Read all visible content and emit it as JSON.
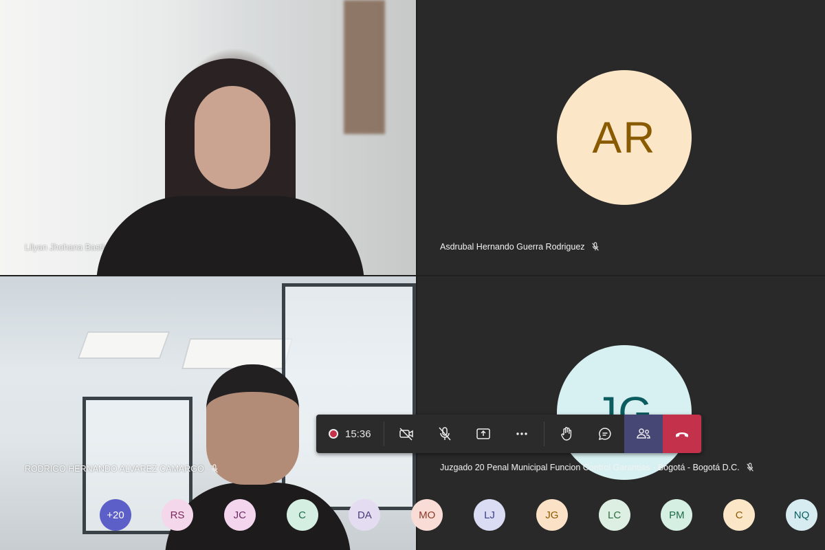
{
  "participants": {
    "tile1_name": "Lilyan Jhohana Bastidas Huertas",
    "tile2_name": "Asdrubal Hernando Guerra Rodriguez",
    "tile2_initials": "AR",
    "tile3_name": "RODRIGO HERNANDO ALVAREZ CAMARGO",
    "tile4_name": "Juzgado 20 Penal Municipal Funcion Control Garantias - Bogotá - Bogotá D.C.",
    "tile4_initials": "JG"
  },
  "toolbar": {
    "timer": "15:36",
    "icons": [
      "record-icon",
      "camera-off-icon",
      "mic-off-icon",
      "share-screen-icon",
      "more-icon",
      "raise-hand-icon",
      "chat-icon",
      "participants-icon",
      "hang-up-icon"
    ]
  },
  "overflow": {
    "more_count": "+20",
    "avatars": [
      {
        "initials": "RS",
        "bg": "#f4d7ea",
        "fg": "#7a2a5c"
      },
      {
        "initials": "JC",
        "bg": "#f3d6ee",
        "fg": "#6b2c62"
      },
      {
        "initials": "C",
        "bg": "#d4efe2",
        "fg": "#1f6b48"
      },
      {
        "initials": "DA",
        "bg": "#e4dcf1",
        "fg": "#4a3a7a"
      },
      {
        "initials": "MO",
        "bg": "#f9dcd6",
        "fg": "#8a3a2a"
      },
      {
        "initials": "LJ",
        "bg": "#dadcf3",
        "fg": "#3a3f86"
      },
      {
        "initials": "JG",
        "bg": "#fbe2c6",
        "fg": "#8a5a00"
      },
      {
        "initials": "LC",
        "bg": "#dcefe2",
        "fg": "#2e6b42"
      },
      {
        "initials": "PM",
        "bg": "#d5efe3",
        "fg": "#1f6b48"
      },
      {
        "initials": "C",
        "bg": "#fbe7c8",
        "fg": "#8a5a00"
      },
      {
        "initials": "NQ",
        "bg": "#d7ecf0",
        "fg": "#0b5c5f"
      }
    ],
    "more_bg": "#5b5fc7"
  }
}
